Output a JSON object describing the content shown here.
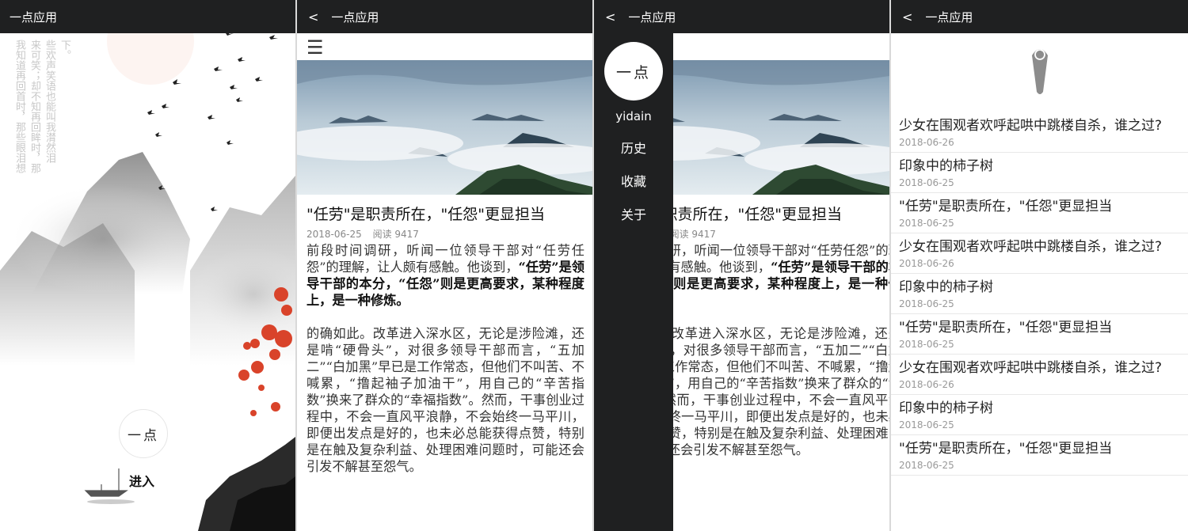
{
  "app_title": "一点应用",
  "back_glyph": "<",
  "splash": {
    "poem_lines": [
      "下。",
      "些欢声笑语也能叫我潸然泪",
      "来可笑；却不知再回眸时，那",
      "我知道再回首时，那些眼泪想"
    ],
    "logo_text": "一点",
    "enter_label": "进入"
  },
  "article": {
    "menu_glyph": "☰",
    "title": "\"任劳\"是职责所在，\"任怨\"更显担当",
    "date": "2018-06-25",
    "reads": "阅读 9417",
    "para1_normal": "前段时间调研，听闻一位领导干部对“任劳任怨”的理解，让人颇有感触。他谈到，",
    "para1_bold": "“任劳”是领导干部的本分，“任怨”则是更高要求，某种程度上，是一种修炼。",
    "para2": "的确如此。改革进入深水区，无论是涉险滩，还是啃“硬骨头”，对很多领导干部而言，“五加二”“白加黑”早已是工作常态，但他们不叫苦、不喊累，“撸起袖子加油干”，用自己的“辛苦指数”换来了群众的“幸福指数”。然而，干事创业过程中，不会一直风平浪静，不会始终一马平川，即便出发点是好的，也未必总能获得点赞，特别是在触及复杂利益、处理困难问题时，可能还会引发不解甚至怨气。"
  },
  "drawer": {
    "avatar_text": "一点",
    "username": "yidain",
    "menu": [
      "历史",
      "收藏",
      "关于"
    ]
  },
  "history": {
    "items": [
      {
        "title": "少女在围观者欢呼起哄中跳楼自杀，谁之过?",
        "date": "2018-06-26"
      },
      {
        "title": "印象中的柿子树",
        "date": "2018-06-25"
      },
      {
        "title": "\"任劳\"是职责所在，\"任怨\"更显担当",
        "date": "2018-06-25"
      },
      {
        "title": "少女在围观者欢呼起哄中跳楼自杀，谁之过?",
        "date": "2018-06-26"
      },
      {
        "title": "印象中的柿子树",
        "date": "2018-06-25"
      },
      {
        "title": "\"任劳\"是职责所在，\"任怨\"更显担当",
        "date": "2018-06-25"
      },
      {
        "title": "少女在围观者欢呼起哄中跳楼自杀，谁之过?",
        "date": "2018-06-26"
      },
      {
        "title": "印象中的柿子树",
        "date": "2018-06-25"
      },
      {
        "title": "\"任劳\"是职责所在，\"任怨\"更显担当",
        "date": "2018-06-25"
      }
    ]
  },
  "colors": {
    "topbar": "#1f2021",
    "accent_red": "#d9432a",
    "sky": "#8aa6bd"
  }
}
